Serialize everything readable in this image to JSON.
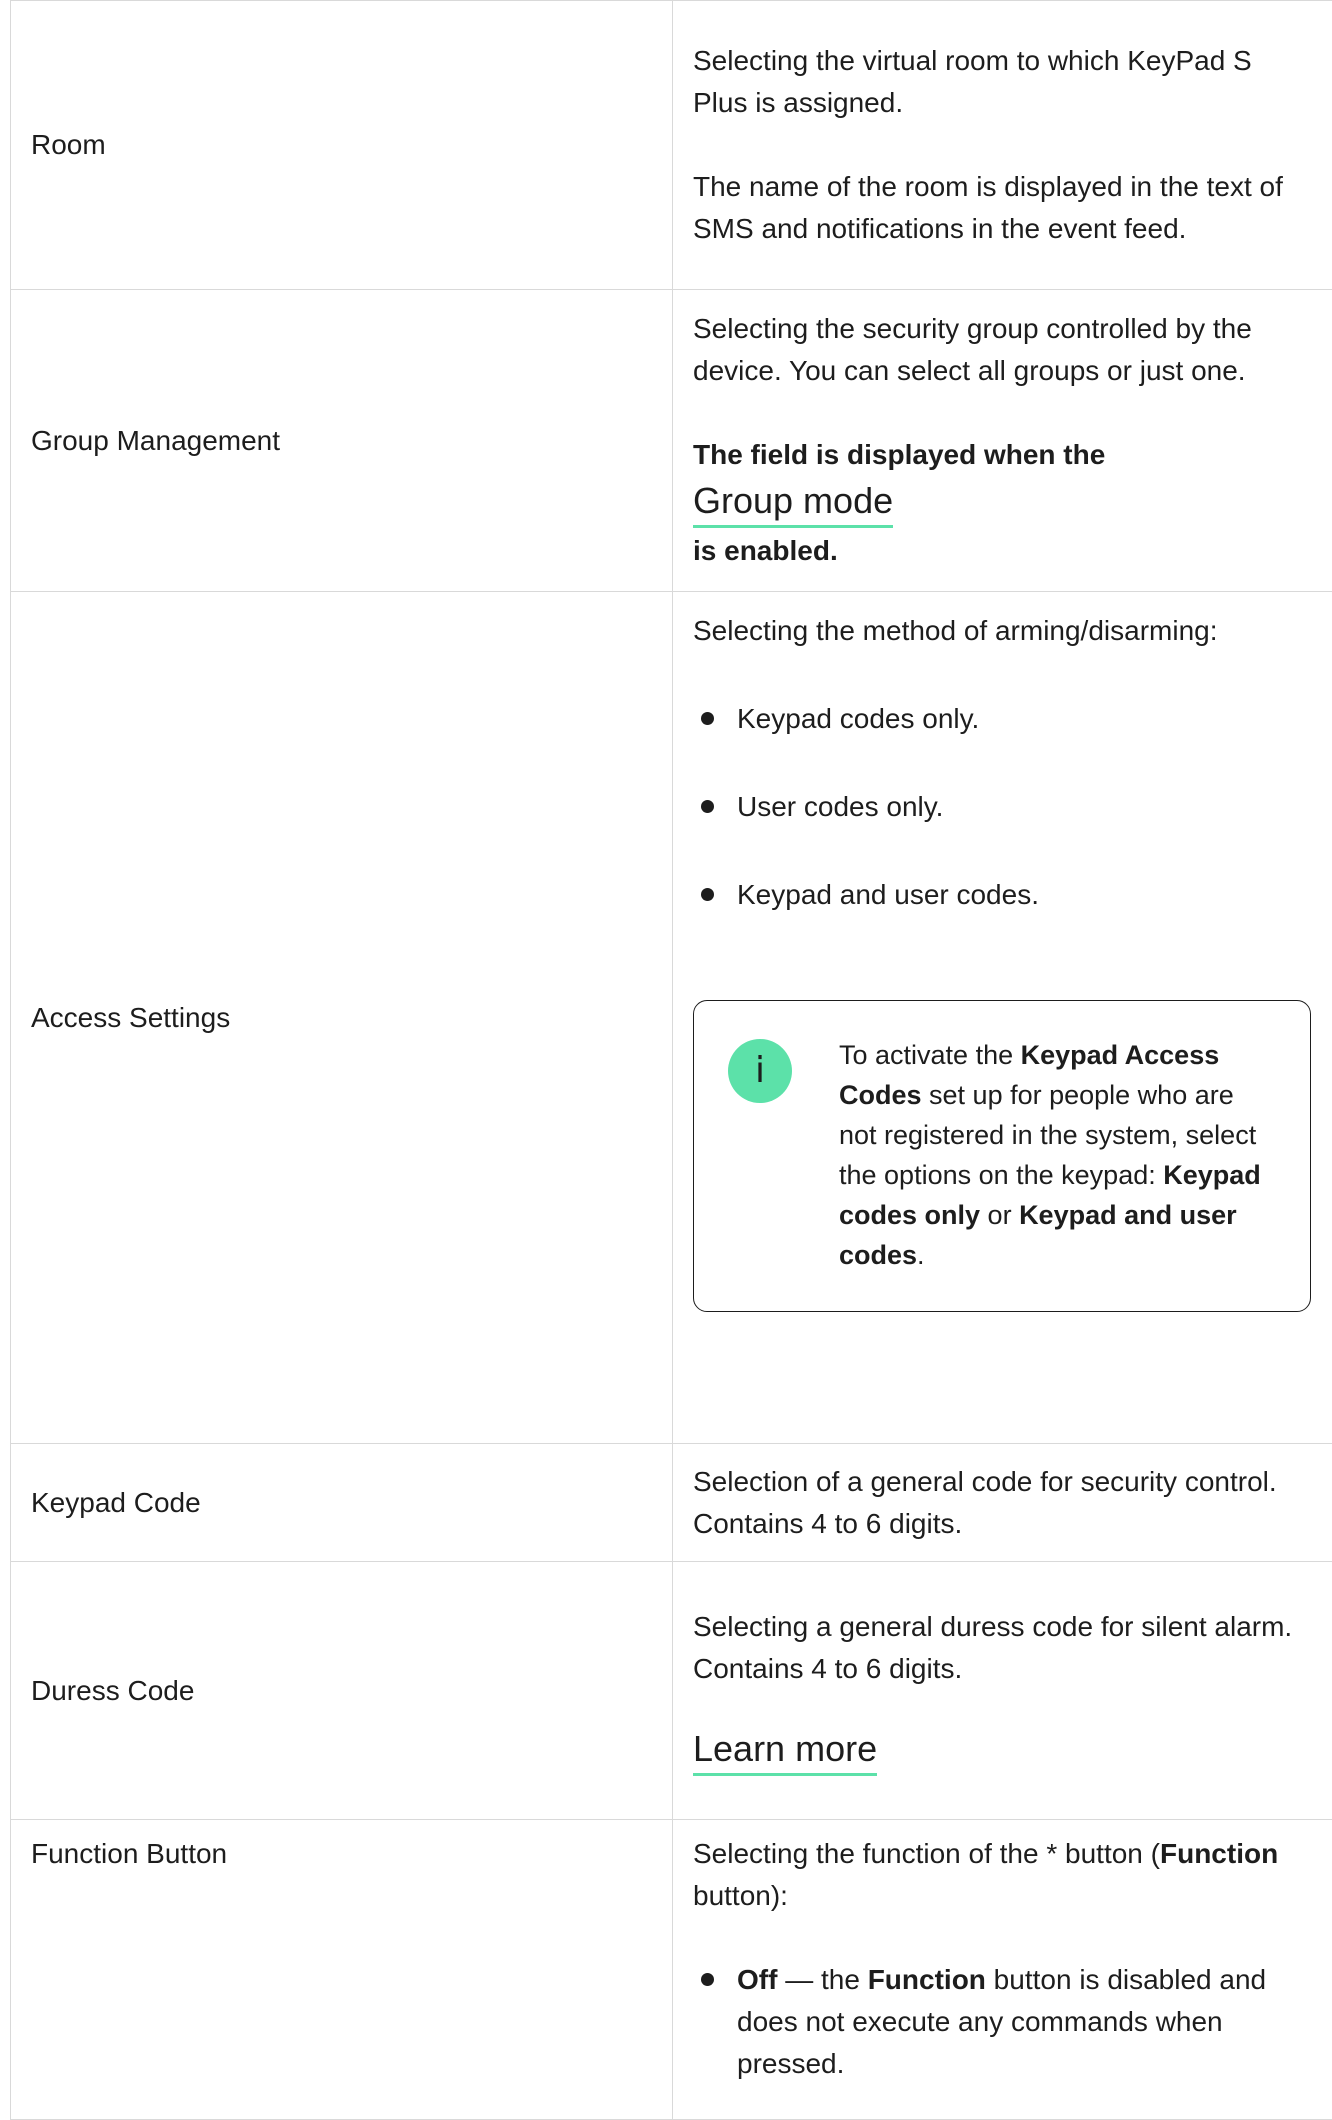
{
  "rows": [
    {
      "name": "Room",
      "desc_p1": "Selecting the virtual room to which KeyPad S Plus is assigned.",
      "desc_p2": "The name of the room is displayed in the text of SMS and notifications in the event feed."
    },
    {
      "name": "Group Management",
      "desc_p1": "Selecting the security group controlled by the device. You can select all groups or just one.",
      "note_prefix": "The field is displayed when the ",
      "note_link": "Group mode",
      "note_suffix": "is enabled."
    },
    {
      "name": "Access Settings",
      "desc_p1": "Selecting the method of arming/disarming:",
      "options": [
        "Keypad codes only.",
        "User codes only.",
        "Keypad and user codes."
      ],
      "info": {
        "icon": "info-icon",
        "icon_glyph": "i",
        "t1": "To activate the ",
        "b1": "Keypad Access Codes",
        "t2": " set up for people who are not registered in the system, select the options on the keypad: ",
        "b2": "Keypad codes only",
        "t3": " or ",
        "b3": "Keypad and user codes",
        "t4": "."
      }
    },
    {
      "name": "Keypad Code",
      "desc_p1": "Selection of a general code for security control. Contains 4 to 6 digits."
    },
    {
      "name": "Duress Code",
      "desc_p1": "Selecting a general duress code for silent alarm. Contains 4 to 6 digits.",
      "link": "Learn more"
    },
    {
      "name": "Function Button",
      "t1": "Selecting the function of the * button (",
      "b1": "Function",
      "t2": " button):",
      "item_b1": "Off",
      "item_t1": " — the ",
      "item_b2": "Function",
      "item_t2": " button is disabled and does not execute any commands when pressed."
    }
  ],
  "colors": {
    "accent": "#5ce1a9",
    "border": "#d9d9d9",
    "text": "#1d1d1d"
  }
}
